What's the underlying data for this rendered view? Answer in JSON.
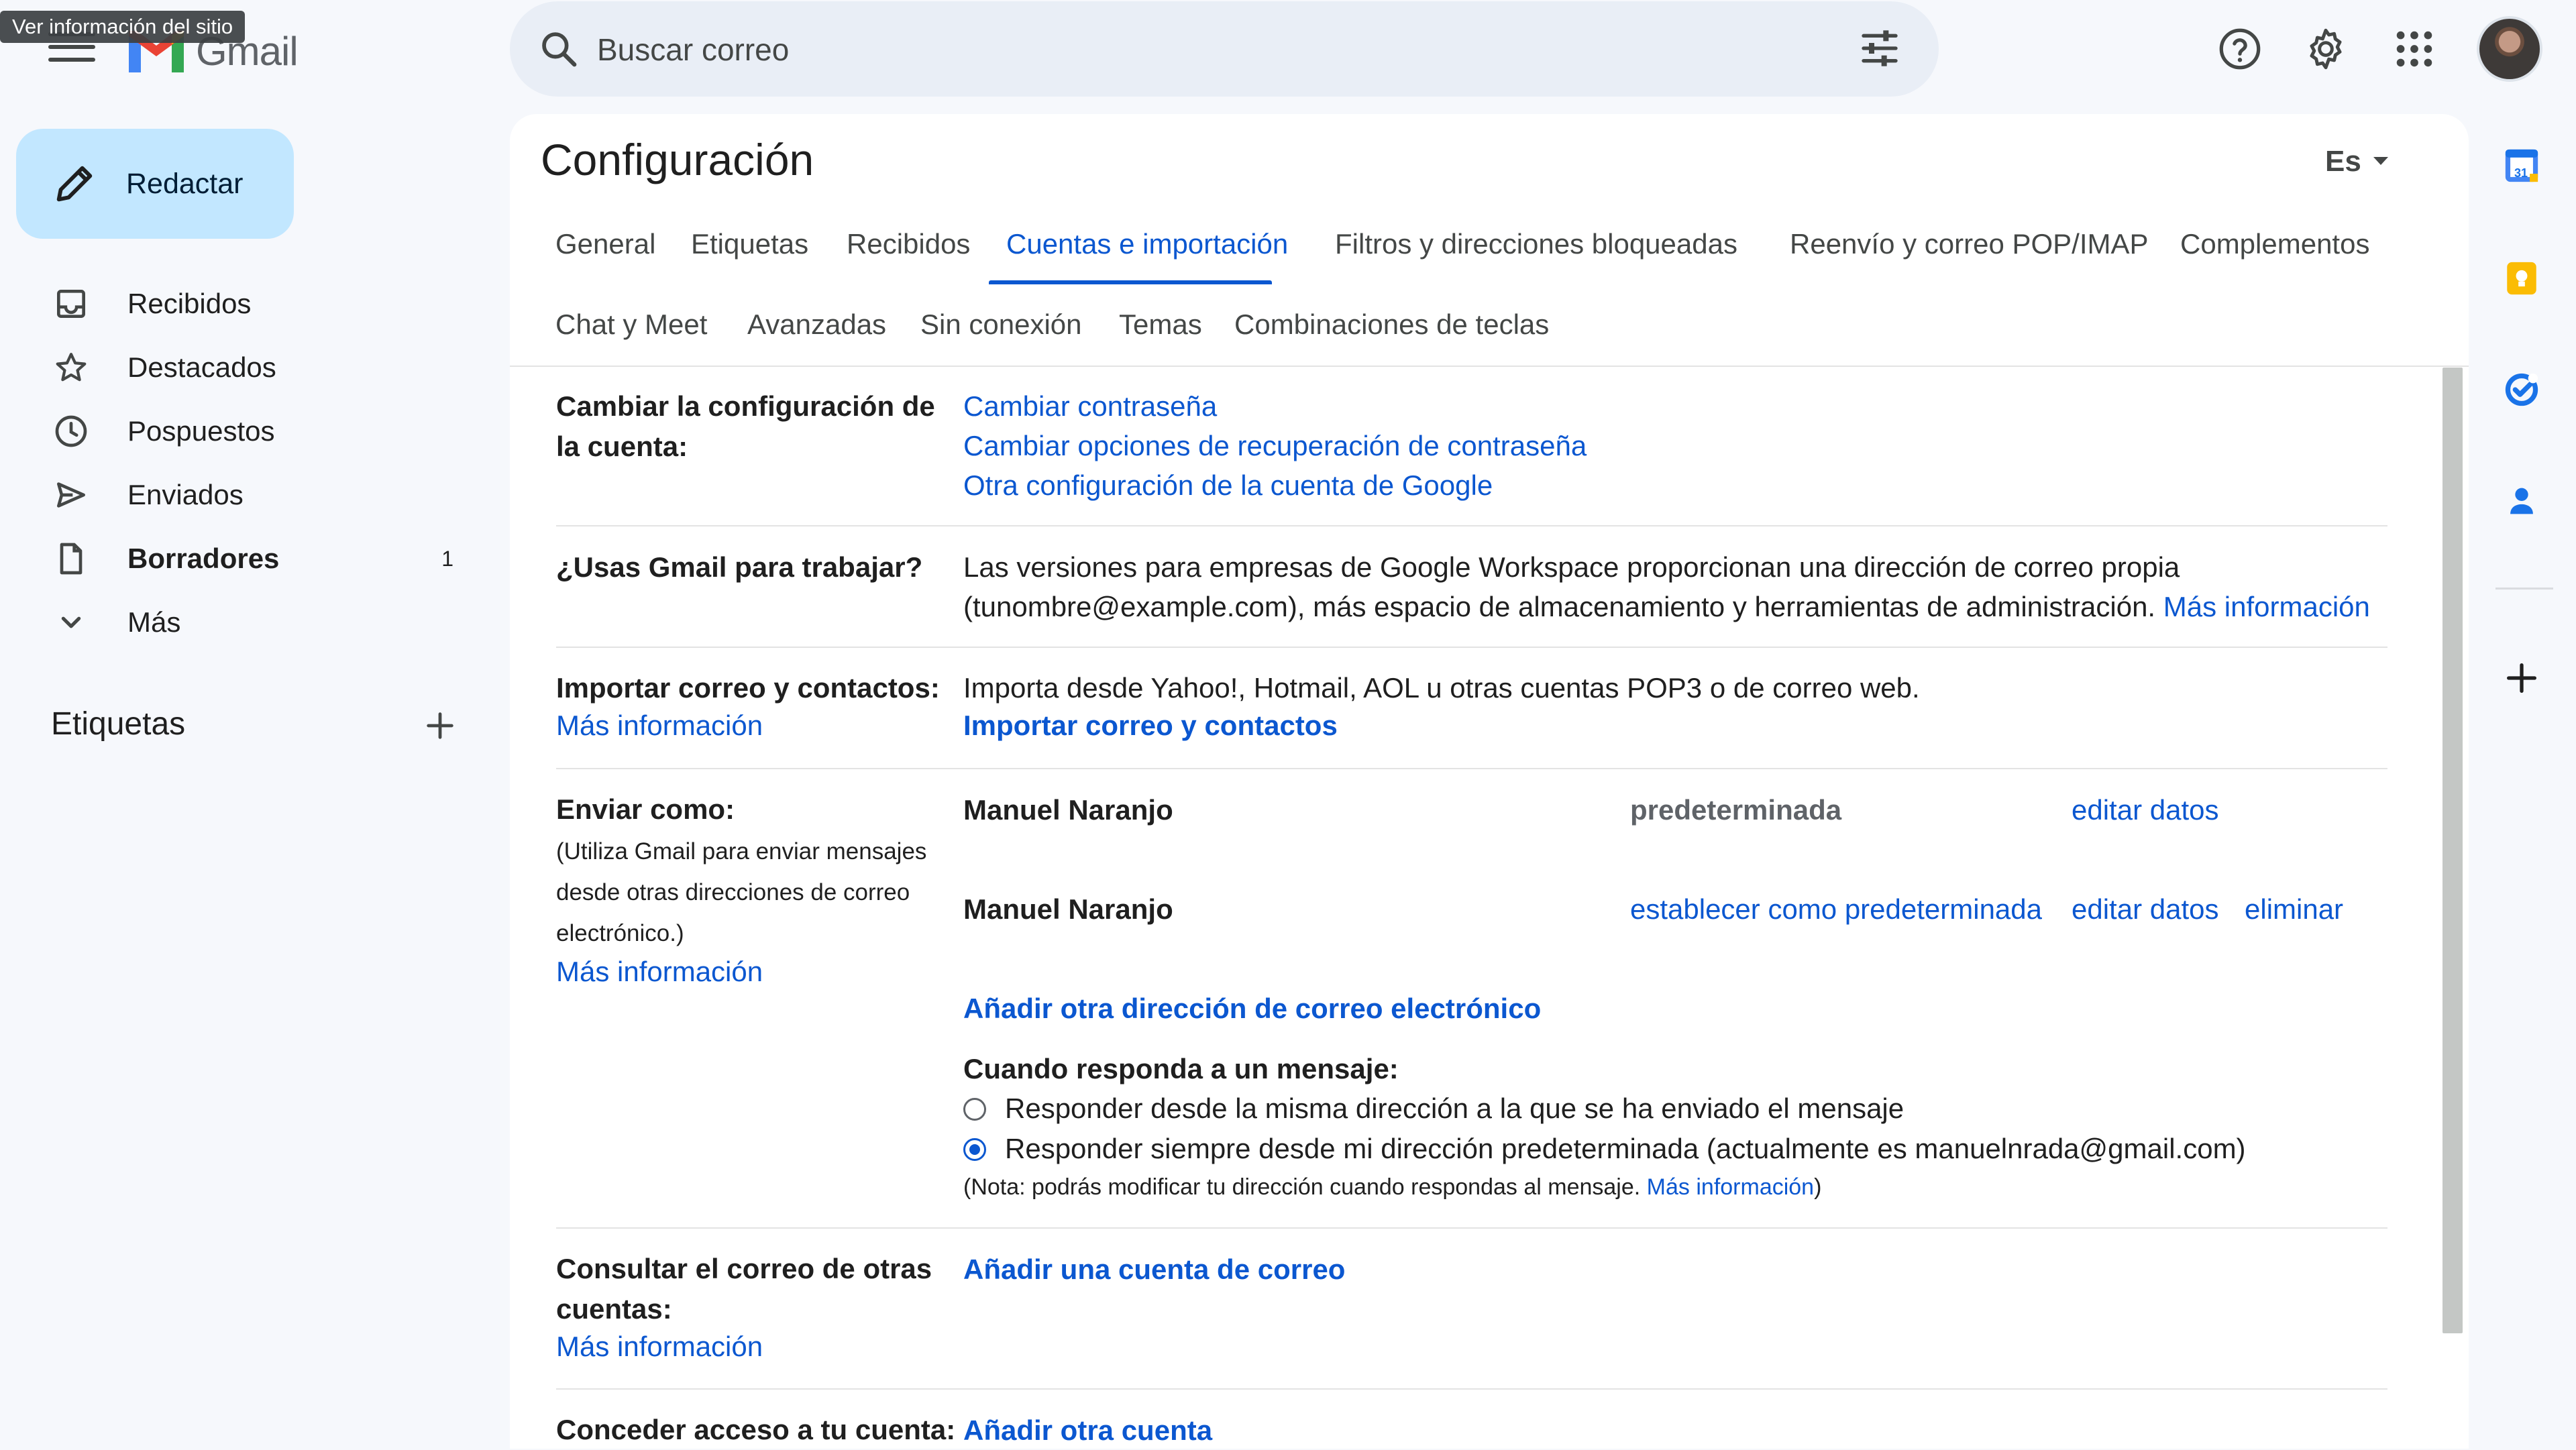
{
  "header": {
    "logo_text": "Gmail",
    "tooltip": "Ver información del sitio",
    "search_placeholder": "Buscar correo"
  },
  "sidebar": {
    "compose_label": "Redactar",
    "items": [
      {
        "label": "Recibidos",
        "count": ""
      },
      {
        "label": "Destacados",
        "count": ""
      },
      {
        "label": "Pospuestos",
        "count": ""
      },
      {
        "label": "Enviados",
        "count": ""
      },
      {
        "label": "Borradores",
        "count": "1"
      },
      {
        "label": "Más",
        "count": ""
      }
    ],
    "labels_heading": "Etiquetas"
  },
  "settings": {
    "title": "Configuración",
    "input_tool": "Es",
    "tabs_row1": [
      "General",
      "Etiquetas",
      "Recibidos",
      "Cuentas e importación",
      "Filtros y direcciones bloqueadas",
      "Reenvío y correo POP/IMAP",
      "Complementos"
    ],
    "tabs_row2": [
      "Chat y Meet",
      "Avanzadas",
      "Sin conexión",
      "Temas",
      "Combinaciones de teclas"
    ],
    "active_tab": "Cuentas e importación",
    "change_account": {
      "label_line1": "Cambiar la configuración de",
      "label_line2": "la cuenta:",
      "links": [
        "Cambiar contraseña",
        "Cambiar opciones de recuperación de contraseña",
        "Otra configuración de la cuenta de Google"
      ]
    },
    "work": {
      "label": "¿Usas Gmail para trabajar?",
      "text_line1": "Las versiones para empresas de Google Workspace proporcionan una dirección de correo propia",
      "text_line2": "(tunombre@example.com), más espacio de almacenamiento y herramientas de administración.",
      "link": "Más información"
    },
    "import": {
      "label": "Importar correo y contactos:",
      "link_more": "Más información",
      "text": "Importa desde Yahoo!, Hotmail, AOL u otras cuentas POP3 o de correo web.",
      "action": "Importar correo y contactos"
    },
    "send_as": {
      "label": "Enviar como:",
      "desc_lines": [
        "(Utiliza Gmail para enviar mensajes",
        "desde otras direcciones de correo",
        "electrónico.)"
      ],
      "link_more": "Más información",
      "rows": [
        {
          "name": "Manuel Naranjo",
          "status": "predeterminada",
          "edit": "editar datos",
          "delete": ""
        },
        {
          "name": "Manuel Naranjo",
          "status": "establecer como predeterminada",
          "edit": "editar datos",
          "delete": "eliminar"
        }
      ],
      "add_address": "Añadir otra dirección de correo electrónico",
      "reply_heading": "Cuando responda a un mensaje:",
      "reply_options": [
        {
          "label": "Responder desde la misma dirección a la que se ha enviado el mensaje",
          "selected": false
        },
        {
          "label": "Responder siempre desde mi dirección predeterminada (actualmente es manuelnrada@gmail.com)",
          "selected": true
        }
      ],
      "note_prefix": "(Nota: podrás modificar tu dirección cuando respondas al mensaje.",
      "note_link": "Más información",
      "note_suffix": ")"
    },
    "check_mail": {
      "label_line1": "Consultar el correo de otras",
      "label_line2": "cuentas:",
      "link_more": "Más información",
      "action": "Añadir una cuenta de correo"
    },
    "grant": {
      "label": "Conceder acceso a tu cuenta:",
      "action": "Añadir otra cuenta"
    }
  },
  "side_panel": {
    "calendar_day": "31"
  },
  "colors": {
    "accent": "#0b57d0",
    "compose_bg": "#c2e7ff",
    "page_bg": "#f6f8fc"
  }
}
